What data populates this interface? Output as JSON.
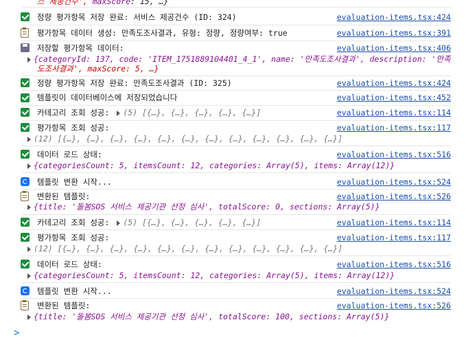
{
  "top_fragment": {
    "text_a": "스 제공건수",
    "text_b": "', ",
    "key": "maxScore",
    "rest": ": 15, …}"
  },
  "messages": [
    {
      "icon": "check",
      "text": "정량 평가항목 저장 완료: 서비스 제공건수 (ID: 324)",
      "source": "evaluation-items.tsx:424"
    },
    {
      "icon": "clip",
      "text": "평가항목 데이터 생성: 만족도조사결과, 유형: 정량, 정량여부: true",
      "source": "evaluation-items.tsx:391"
    },
    {
      "icon": "disk",
      "text": "저장할 평가항목 데이터:",
      "source": "evaluation-items.tsx:406",
      "detail_line1_a": "{categoryId: 137, code: 'ITEM_1751889104401_4_1', name: '만족도조사결과', description: '만족",
      "detail_line2": "도조사결과', maxScore: 5, …}"
    },
    {
      "icon": "check",
      "text": "정량 평가항목 저장 완료: 만족도조사결과 (ID: 325)",
      "source": "evaluation-items.tsx:424"
    },
    {
      "icon": "check",
      "text": "템플릿이 데이터베이스에 저장되었습니다",
      "source": "evaluation-items.tsx:452"
    },
    {
      "icon": "check",
      "text": "카테고리 조회 성공:",
      "inline": "(5) [{…}, {…}, {…}, {…}, {…}]",
      "source": "evaluation-items.tsx:114"
    },
    {
      "icon": "check",
      "text": "평가항목 조회 성공:",
      "detail": "(12) [{…}, {…}, {…}, {…}, {…}, {…}, {…}, {…}, {…}, {…}, {…}, {…}]",
      "source": "evaluation-items.tsx:117"
    },
    {
      "icon": "check",
      "text": "데이터 로드 상태:",
      "detail": "{categoriesCount: 5, itemsCount: 12, categories: Array(5), items: Array(12)}",
      "source": "evaluation-items.tsx:516"
    },
    {
      "icon": "refresh",
      "text": "템플릿 변환 시작...",
      "source": "evaluation-items.tsx:524"
    },
    {
      "icon": "clip",
      "text": "변환된 템플릿:",
      "detail": "{title: '돌봄SOS 서비스 제공기관 선정 심사', totalScore: 0, sections: Array(5)}",
      "source": "evaluation-items.tsx:526"
    },
    {
      "icon": "check",
      "text": "카테고리 조회 성공:",
      "inline": "(5) [{…}, {…}, {…}, {…}, {…}]",
      "source": "evaluation-items.tsx:114"
    },
    {
      "icon": "check",
      "text": "평가항목 조회 성공:",
      "detail": "(12) [{…}, {…}, {…}, {…}, {…}, {…}, {…}, {…}, {…}, {…}, {…}, {…}]",
      "source": "evaluation-items.tsx:117"
    },
    {
      "icon": "check",
      "text": "데이터 로드 상태:",
      "detail": "{categoriesCount: 5, itemsCount: 12, categories: Array(5), items: Array(12)}",
      "source": "evaluation-items.tsx:516"
    },
    {
      "icon": "refresh",
      "text": "템플릿 변환 시작...",
      "source": "evaluation-items.tsx:524"
    },
    {
      "icon": "clip",
      "text": "변환된 템플릿:",
      "detail": "{title: '돌봄SOS 서비스 제공기관 선정 심사', totalScore: 100, sections: Array(5)}",
      "source": "evaluation-items.tsx:526"
    }
  ],
  "prompt_symbol": ">"
}
